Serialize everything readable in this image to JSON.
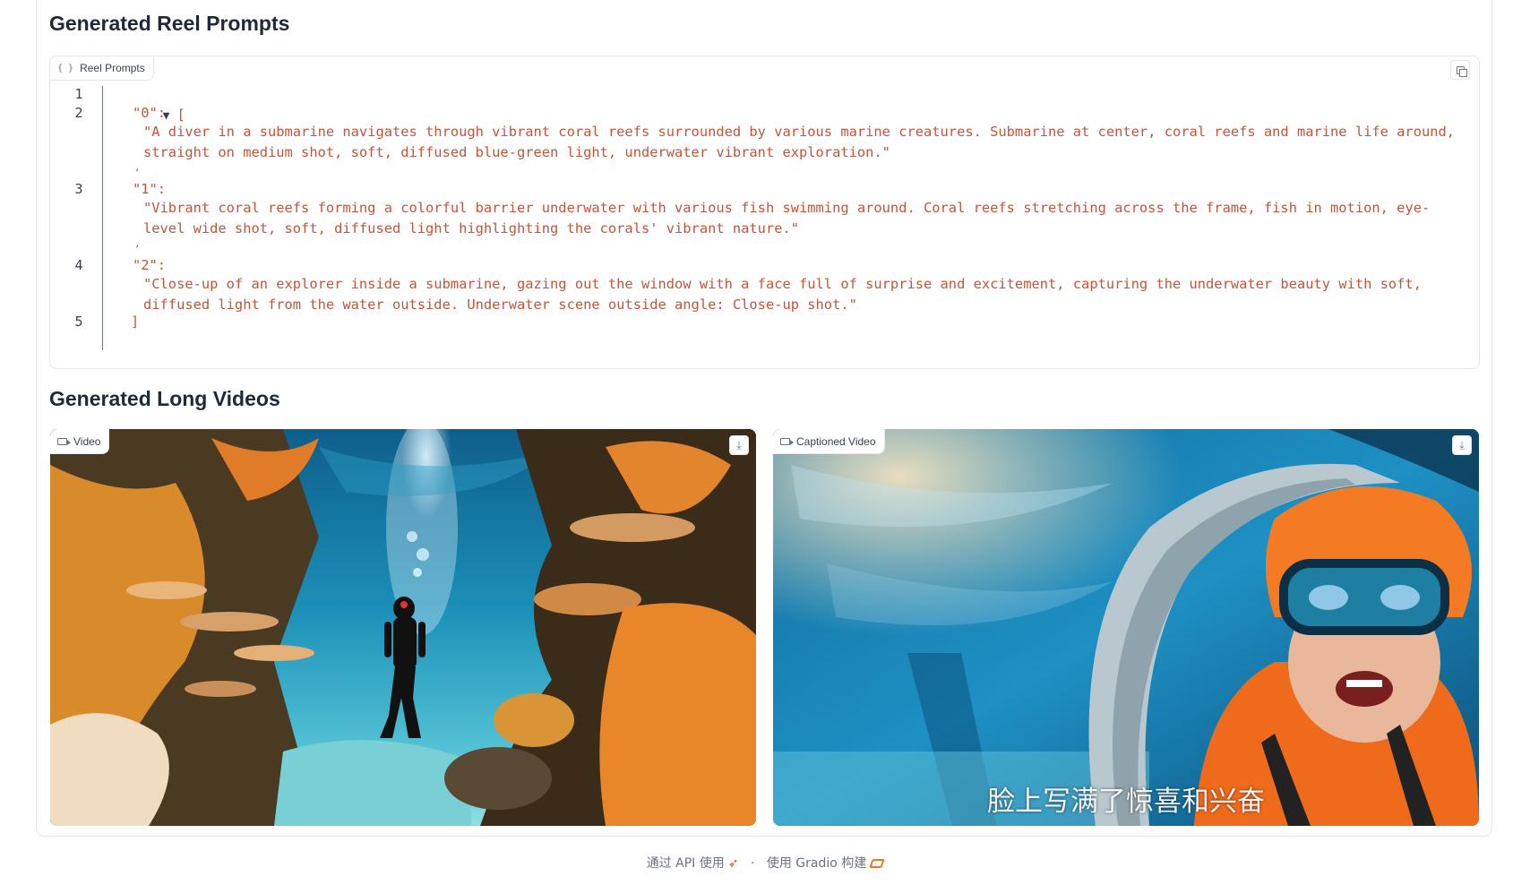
{
  "sections": {
    "prompts_title": "Generated Reel Prompts",
    "videos_title": "Generated Long Videos"
  },
  "code_block": {
    "label": "Reel Prompts",
    "label_icon": "code-braces-icon",
    "copy_icon": "copy-icon",
    "line_numbers": [
      "1",
      "2",
      "3",
      "4",
      "5"
    ],
    "open_bracket": "[",
    "close_bracket": "]",
    "entries": [
      {
        "key": "\"0\":",
        "value": "\"A diver in a submarine navigates through vibrant coral reefs surrounded by various marine creatures. Submarine at center, coral reefs and marine life around, straight on medium shot, soft, diffused blue-green light, underwater vibrant exploration.\"",
        "sep": ","
      },
      {
        "key": "\"1\":",
        "value": "\"Vibrant coral reefs forming a colorful barrier underwater with various fish swimming around. Coral reefs stretching across the frame, fish in motion, eye-level wide shot, soft, diffused light highlighting the corals' vibrant nature.\"",
        "sep": ","
      },
      {
        "key": "\"2\":",
        "value": "\"Close-up of an explorer inside a submarine, gazing out the window with a face full of surprise and excitement, capturing the underwater beauty with soft, diffused light from the water outside. Underwater scene outside angle: Close-up shot.\"",
        "sep": ""
      }
    ]
  },
  "videos": {
    "left_label": "Video",
    "right_label": "Captioned Video",
    "camera_icon": "video-camera-icon",
    "download_icon": "download-icon",
    "caption": "脸上写满了惊喜和兴奋"
  },
  "footer": {
    "api_text": "通过 API 使用",
    "separator": "·",
    "built_text": "使用 Gradio 构建",
    "rocket_icon": "rocket-icon",
    "gradio_icon": "gradio-logo-icon"
  },
  "colors": {
    "code_string": "#c2553a",
    "border": "#e5e7eb",
    "footer_text": "#6b7280"
  }
}
